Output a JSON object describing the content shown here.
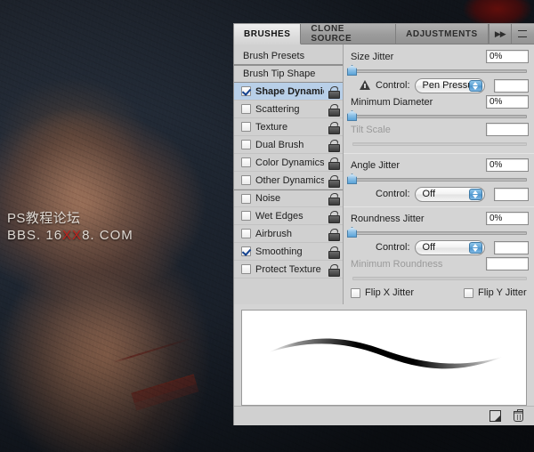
{
  "background": {
    "watermark_line1": "PS教程论坛",
    "watermark_line2_a": "BBS. 16",
    "watermark_line2_red": "XX",
    "watermark_line2_b": "8. COM",
    "watermark_red_color": "#c4201c"
  },
  "panel": {
    "tabs": [
      {
        "label": "BRUSHES",
        "active": true
      },
      {
        "label": "CLONE SOURCE",
        "active": false
      },
      {
        "label": "ADJUSTMENTS",
        "active": false
      }
    ],
    "collapse_icon": "double-chevron-right-icon",
    "menu_icon": "panel-menu-icon"
  },
  "options_list": {
    "presets_label": "Brush Presets",
    "tip_shape_label": "Brush Tip Shape",
    "items": [
      {
        "label": "Shape Dynamics",
        "checked": true,
        "selected": true,
        "locked": true
      },
      {
        "label": "Scattering",
        "checked": false,
        "selected": false,
        "locked": true
      },
      {
        "label": "Texture",
        "checked": false,
        "selected": false,
        "locked": true
      },
      {
        "label": "Dual Brush",
        "checked": false,
        "selected": false,
        "locked": true
      },
      {
        "label": "Color Dynamics",
        "checked": false,
        "selected": false,
        "locked": true
      },
      {
        "label": "Other Dynamics",
        "checked": false,
        "selected": false,
        "locked": true
      },
      {
        "label": "Noise",
        "checked": false,
        "selected": false,
        "locked": true
      },
      {
        "label": "Wet Edges",
        "checked": false,
        "selected": false,
        "locked": true
      },
      {
        "label": "Airbrush",
        "checked": false,
        "selected": false,
        "locked": true
      },
      {
        "label": "Smoothing",
        "checked": true,
        "selected": false,
        "locked": true
      },
      {
        "label": "Protect Texture",
        "checked": false,
        "selected": false,
        "locked": true
      }
    ]
  },
  "shape_dynamics": {
    "size_jitter": {
      "label": "Size Jitter",
      "value": "0%"
    },
    "size_control": {
      "label": "Control:",
      "value": "Pen Pressure",
      "warning": true,
      "side_value": ""
    },
    "minimum_diameter": {
      "label": "Minimum Diameter",
      "value": "0%"
    },
    "tilt_scale": {
      "label": "Tilt Scale",
      "value": "",
      "disabled": true
    },
    "angle_jitter": {
      "label": "Angle Jitter",
      "value": "0%"
    },
    "angle_control": {
      "label": "Control:",
      "value": "Off",
      "warning": false,
      "side_value": ""
    },
    "roundness_jitter": {
      "label": "Roundness Jitter",
      "value": "0%"
    },
    "roundness_control": {
      "label": "Control:",
      "value": "Off",
      "warning": false,
      "side_value": ""
    },
    "minimum_roundness": {
      "label": "Minimum Roundness",
      "value": "",
      "disabled": true
    },
    "flip_x": {
      "label": "Flip X Jitter",
      "checked": false
    },
    "flip_y": {
      "label": "Flip Y Jitter",
      "checked": false
    }
  },
  "footer": {
    "new_brush_icon": "new-brush-icon",
    "delete_brush_icon": "trash-icon"
  }
}
